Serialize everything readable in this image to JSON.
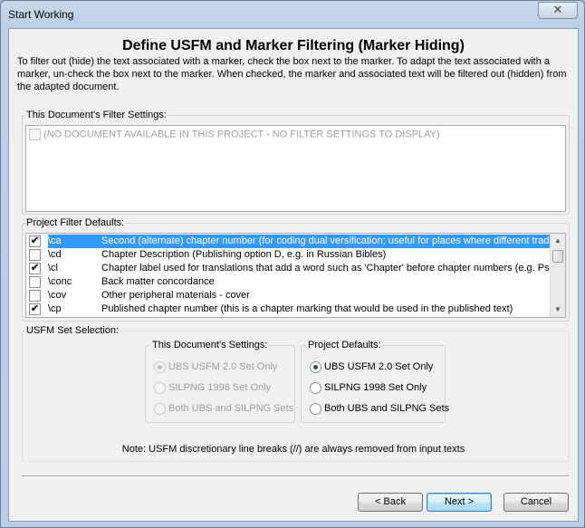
{
  "window": {
    "title": "Start Working",
    "close_glyph": "✕"
  },
  "heading": "Define USFM and Marker Filtering (Marker Hiding)",
  "intro": "To filter out (hide) the text associated with a marker, check the box next to the marker. To adapt the text associated with a marker, un-check the box next to the marker. When checked, the marker and associated text will be filtered out (hidden) from the adapted document.",
  "doc_filter": {
    "label": "This Document's Filter Settings:",
    "empty_text": "(NO DOCUMENT AVAILABLE IN THIS PROJECT - NO FILTER SETTINGS TO DISPLAY)"
  },
  "project_filter": {
    "label": "Project Filter Defaults:",
    "rows": [
      {
        "checked": true,
        "marker": "\\ca",
        "desc": "Second (alternate) chapter number (for coding dual versification; useful for places where different tradi",
        "selected": true
      },
      {
        "checked": false,
        "marker": "\\cd",
        "desc": "Chapter Description (Publishing option D, e.g. in Russian Bibles)",
        "selected": false
      },
      {
        "checked": true,
        "marker": "\\cl",
        "desc": "Chapter label used for translations that add a word such as 'Chapter' before chapter numbers (e.g. Psal",
        "selected": false
      },
      {
        "checked": false,
        "marker": "\\conc",
        "desc": "Back matter concordance",
        "selected": false
      },
      {
        "checked": false,
        "marker": "\\cov",
        "desc": "Other peripheral materials - cover",
        "selected": false
      },
      {
        "checked": true,
        "marker": "\\cp",
        "desc": "Published chapter number (this is a chapter marking that would be used in the published text)",
        "selected": false
      }
    ]
  },
  "usfm_set": {
    "label": "USFM Set Selection:",
    "doc_settings": {
      "label": "This Document's Settings:",
      "options": [
        "UBS USFM 2.0 Set Only",
        "SILPNG 1998 Set Only",
        "Both UBS and SILPNG Sets"
      ],
      "selected_index": 0,
      "enabled": false
    },
    "project_defaults": {
      "label": "Project Defaults:",
      "options": [
        "UBS USFM 2.0 Set Only",
        "SILPNG 1998 Set Only",
        "Both UBS and SILPNG Sets"
      ],
      "selected_index": 0,
      "enabled": true
    },
    "note": "Note: USFM discretionary line breaks (//) are always removed from input texts"
  },
  "buttons": {
    "back": "< Back",
    "next": "Next >",
    "cancel": "Cancel"
  }
}
